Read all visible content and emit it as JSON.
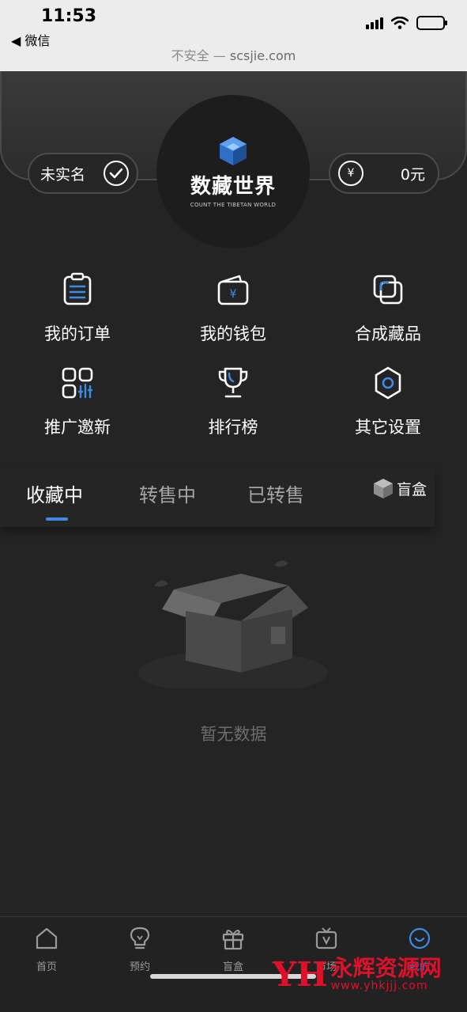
{
  "status_bar": {
    "time": "11:53",
    "back_app": "◀ 微信"
  },
  "browser": {
    "security": "不安全 — ",
    "host": "scsjie.com"
  },
  "profile": {
    "verify_label": "未实名",
    "balance_symbol": "¥",
    "balance": "0元",
    "logo_title": "数藏世界",
    "logo_subtitle": "COUNT THE TIBETAN WORLD"
  },
  "menu": [
    {
      "label": "我的订单",
      "icon": "order-list-icon"
    },
    {
      "label": "我的钱包",
      "icon": "wallet-icon"
    },
    {
      "label": "合成藏品",
      "icon": "compose-icon"
    },
    {
      "label": "推广邀新",
      "icon": "promote-icon"
    },
    {
      "label": "排行榜",
      "icon": "trophy-icon"
    },
    {
      "label": "其它设置",
      "icon": "settings-gear-icon"
    }
  ],
  "tabs": [
    {
      "label": "收藏中",
      "active": true
    },
    {
      "label": "转售中",
      "active": false
    },
    {
      "label": "已转售",
      "active": false
    }
  ],
  "blindbox_tab": {
    "label": "盲盒"
  },
  "empty_state": {
    "text": "暂无数据"
  },
  "bottom_nav": [
    {
      "label": "首页",
      "icon": "home-icon",
      "active": false
    },
    {
      "label": "预约",
      "icon": "lightbulb-icon",
      "active": false
    },
    {
      "label": "盲盒",
      "icon": "gift-icon",
      "active": false
    },
    {
      "label": "市场",
      "icon": "tv-market-icon",
      "active": false
    },
    {
      "label": "我的",
      "icon": "smile-icon",
      "active": true
    }
  ],
  "watermark": {
    "logo": "YH",
    "name": "永辉资源网",
    "url": "www.yhkjjj.com"
  },
  "colors": {
    "accent": "#3d8be6",
    "background": "#242424",
    "watermark": "#e0102a"
  }
}
